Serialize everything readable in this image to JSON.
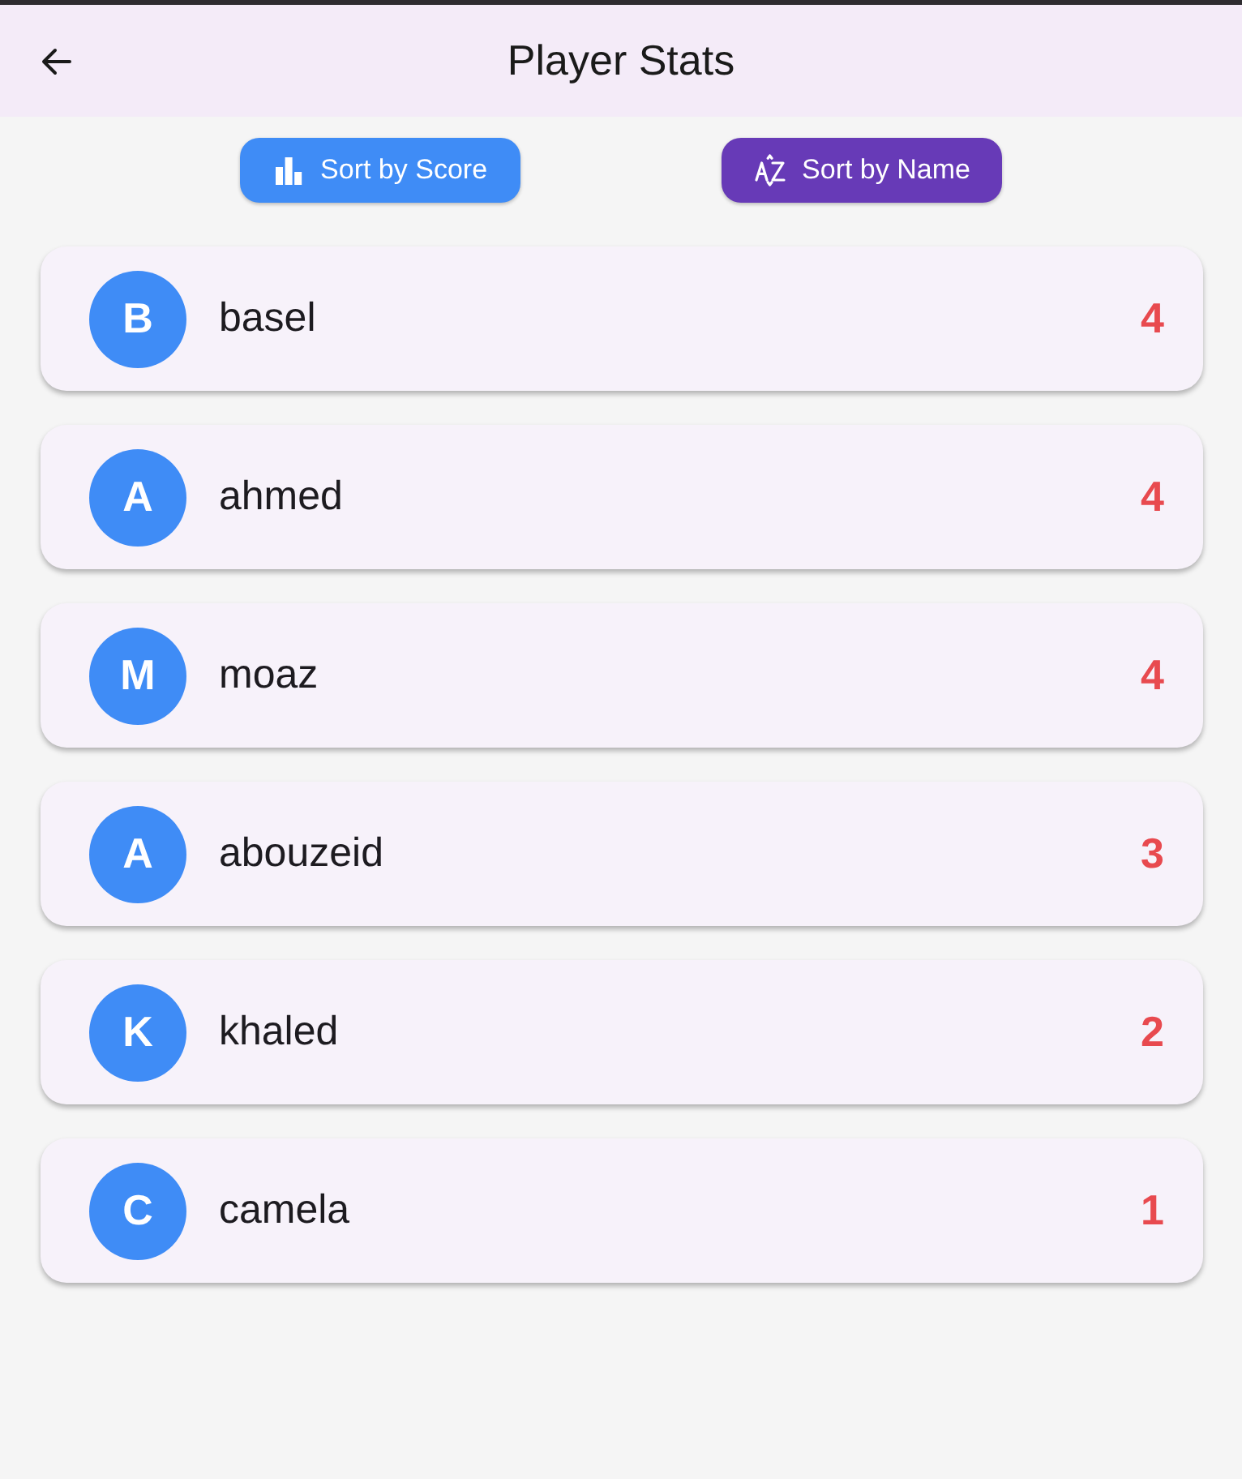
{
  "app_bar": {
    "title": "Player Stats"
  },
  "sort_buttons": [
    {
      "label": "Sort by Score",
      "kind": "score",
      "color": "#3f8cf6"
    },
    {
      "label": "Sort by Name",
      "kind": "name",
      "color": "#673ab7"
    }
  ],
  "players": [
    {
      "initial": "B",
      "name": "basel",
      "score": "4"
    },
    {
      "initial": "A",
      "name": "ahmed",
      "score": "4"
    },
    {
      "initial": "M",
      "name": "moaz",
      "score": "4"
    },
    {
      "initial": "A",
      "name": "abouzeid",
      "score": "3"
    },
    {
      "initial": "K",
      "name": "khaled",
      "score": "2"
    },
    {
      "initial": "C",
      "name": "camela",
      "score": "1"
    }
  ]
}
